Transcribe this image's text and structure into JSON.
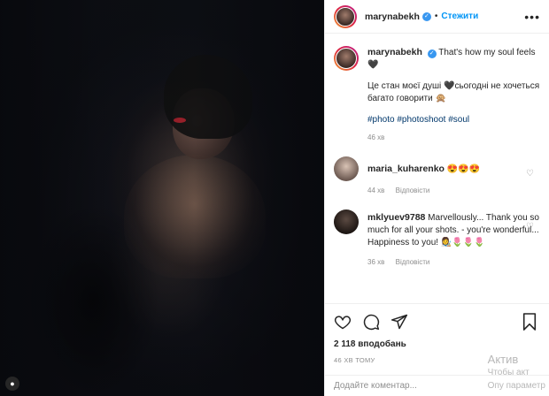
{
  "post": {
    "username": "marynabekh",
    "follow_label": "Стежити",
    "dot": "•",
    "more": "•••"
  },
  "caption": {
    "username": "marynabekh",
    "line1": "That's how my soul feels🖤",
    "line2": "Це стан моєї душі 🖤сьогодні не хочеться багато говорити 🙊",
    "tags": "#photo #photoshoot #soul",
    "time": "46 хв"
  },
  "comments": [
    {
      "username": "maria_kuharenko",
      "text": "😍😍😍",
      "time": "44 хв",
      "reply_label": "Відповісти"
    },
    {
      "username": "mklyuev9788",
      "text": "Marvellously... Thank you so much for all your shots. - you're wonderful... Happiness to you! 👩‍🎨🌷🌷🌷",
      "time": "36 хв",
      "reply_label": "Відповісти"
    }
  ],
  "actions": {
    "likes": "2 118 вподобань",
    "timestamp": "46 ХВ ТОМУ"
  },
  "add_comment": {
    "placeholder": "Додайте коментар..."
  },
  "watermark": {
    "line1": "Актив",
    "line2": "Чтобы акт",
    "line3": "Опу параметр"
  },
  "icons": {
    "like": "heart-icon",
    "comment": "comment-icon",
    "share": "share-icon",
    "save": "bookmark-icon"
  }
}
